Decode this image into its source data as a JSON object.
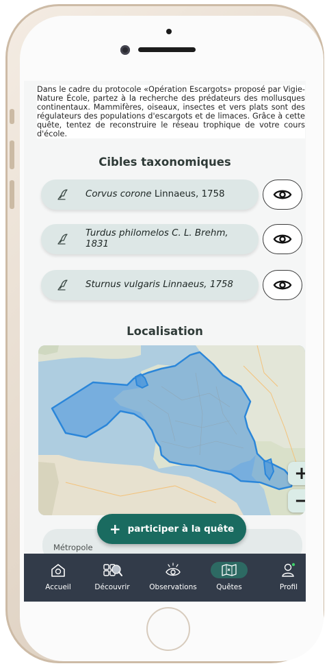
{
  "intro_text": "Dans le cadre du protocole «Opération Escargots» proposé par Vigie-Nature École, partez à la recherche des prédateurs des mollusques continentaux. Mammifères, oiseaux, insectes et vers plats sont des régulateurs des populations d'escargots et de limaces. Grâce à cette quête, tentez de reconstruire le réseau trophique de votre cours d'école.",
  "targets": {
    "title": "Cibles taxonomiques",
    "items": [
      {
        "name": "Corvus corone",
        "author": " Linnaeus, 1758"
      },
      {
        "name": "Turdus philomelos C. L. Brehm, 1831",
        "author": ""
      },
      {
        "name": "Sturnus vulgaris Linnaeus, 1758",
        "author": ""
      }
    ]
  },
  "location": {
    "title": "Localisation",
    "zoom_in": "+",
    "zoom_out": "−",
    "region": "Métropole"
  },
  "cta_label": "participer à la quête",
  "cta_icon": "+",
  "tabs": [
    {
      "label": "Accueil",
      "icon": "home-icon"
    },
    {
      "label": "Découvrir",
      "icon": "discover-icon"
    },
    {
      "label": "Observations",
      "icon": "observations-eye-icon"
    },
    {
      "label": "Quêtes",
      "icon": "quests-map-icon",
      "active": true
    },
    {
      "label": "Profil",
      "icon": "profile-icon"
    }
  ],
  "colors": {
    "primary": "#1a6b60",
    "pill_bg": "#dde7e6",
    "tabbar_bg": "#323b49",
    "map_overlay": "#2b86d9"
  }
}
